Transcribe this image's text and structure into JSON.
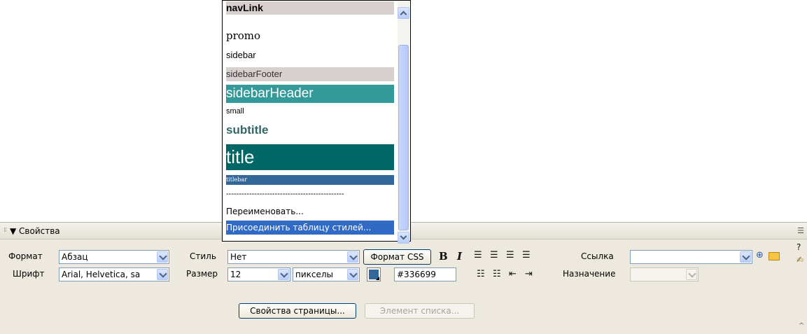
{
  "dropdown": {
    "items": [
      {
        "label": "navLink"
      },
      {
        "label": "promo"
      },
      {
        "label": "sidebar"
      },
      {
        "label": "sidebarFooter"
      },
      {
        "label": "sidebarHeader"
      },
      {
        "label": "small"
      },
      {
        "label": "subtitle"
      },
      {
        "label": "title"
      },
      {
        "label": "titlebar"
      },
      {
        "label": "----------------------------------------------"
      },
      {
        "label": "Переименовать..."
      },
      {
        "label": "Присоединить таблицу стилей..."
      }
    ],
    "selected_index": 11,
    "colors": {
      "navLink_bg": "#d8cfcf",
      "sidebarFooter_bg": "#d8cfcf",
      "sidebarHeader_bg": "#339999",
      "subtitle_text": "#336666",
      "title_bg": "#006666",
      "titlebar_bg": "#336699",
      "selection": "#316ac5"
    }
  },
  "panel": {
    "title": "Свойства",
    "row1": {
      "format_label": "Формат",
      "format_value": "Абзац",
      "style_label": "Стиль",
      "style_value": "Нет",
      "css_button": "Формат CSS",
      "bold": "B",
      "italic": "I",
      "link_label": "Ссылка",
      "link_value": ""
    },
    "row2": {
      "font_label": "Шрифт",
      "font_value": "Arial, Helvetica, sa",
      "size_label": "Размер",
      "size_value": "12",
      "unit_value": "пикселы",
      "color_value": "#336699",
      "target_label": "Назначение",
      "target_value": ""
    },
    "row3": {
      "page_props_button": "Свойства страницы...",
      "list_item_button": "Элемент списка..."
    },
    "text_color": "#336699"
  }
}
